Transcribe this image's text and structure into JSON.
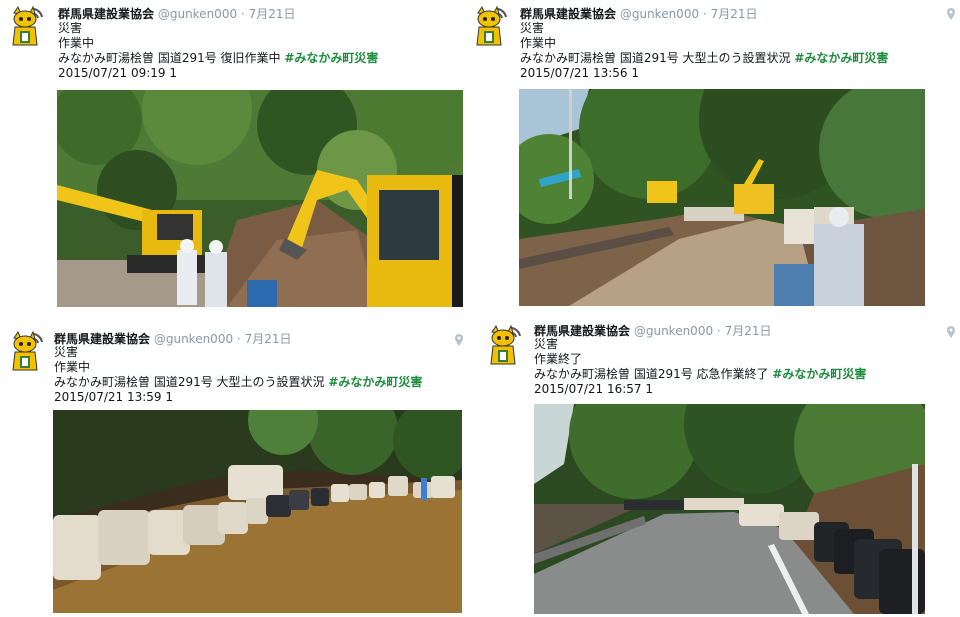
{
  "tweets": [
    {
      "name": "群馬県建設業協会",
      "handle": "@gunken000",
      "sep": "·",
      "date": "7月21日",
      "lines": [
        "災害",
        "作業中"
      ],
      "text": "みなかみ町湯桧曽 国道291号 復旧作業中",
      "hashtag": "#みなかみ町災害",
      "timestamp": "2015/07/21 09:19 1",
      "photo": "excavators-clearing-debris"
    },
    {
      "name": "群馬県建設業協会",
      "handle": "@gunken000",
      "sep": "·",
      "date": "7月21日",
      "lines": [
        "災害",
        "作業中"
      ],
      "text": "みなかみ町湯桧曽 国道291号 大型土のう設置状況",
      "hashtag": "#みなかみ町災害",
      "timestamp": "2015/07/21 13:56 1",
      "photo": "sandbags-along-road-workers"
    },
    {
      "name": "群馬県建設業協会",
      "handle": "@gunken000",
      "sep": "·",
      "date": "7月21日",
      "lines": [
        "災害",
        "作業中"
      ],
      "text": "みなかみ町湯桧曽 国道291号 大型土のう設置状況",
      "hashtag": "#みなかみ町災害",
      "timestamp": "2015/07/21 13:59 1",
      "photo": "row-of-sandbags-muddy-road"
    },
    {
      "name": "群馬県建設業協会",
      "handle": "@gunken000",
      "sep": "·",
      "date": "7月21日",
      "lines": [
        "災害",
        "作業終了"
      ],
      "text": "みなかみ町湯桧曽 国道291号 応急作業終了",
      "hashtag": "#みなかみ町災害",
      "timestamp": "2015/07/21 16:57 1",
      "photo": "cleared-road-with-black-sandbags"
    }
  ],
  "colors": {
    "name": "#14171a",
    "meta": "#8899a6",
    "hashtag": "#1a8c3a",
    "mascot": "#f2c200"
  }
}
